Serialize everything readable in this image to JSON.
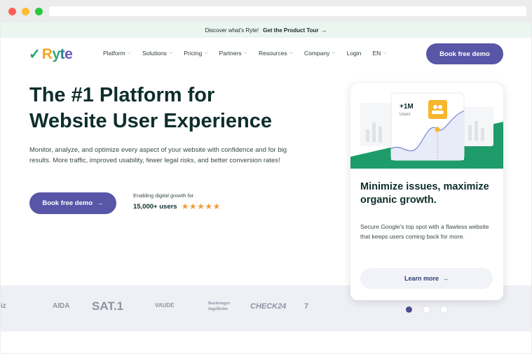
{
  "announcement": {
    "text": "Discover what's Ryte!",
    "cta": "Get the Product Tour",
    "arrow": "→"
  },
  "nav": {
    "logo_check": "✓",
    "logo": [
      "R",
      "y",
      "t",
      "e"
    ],
    "items": [
      {
        "label": "Platform",
        "has_dropdown": true
      },
      {
        "label": "Solutions",
        "has_dropdown": true
      },
      {
        "label": "Pricing",
        "has_dropdown": true
      },
      {
        "label": "Partners",
        "has_dropdown": true
      },
      {
        "label": "Resources",
        "has_dropdown": true
      },
      {
        "label": "Company",
        "has_dropdown": true
      },
      {
        "label": "Login",
        "has_dropdown": false
      },
      {
        "label": "EN",
        "has_dropdown": true
      }
    ],
    "chevron": "⌵",
    "demo_button": "Book free demo"
  },
  "hero": {
    "title_line1": "The #1 Platform for",
    "title_line2": "Website User Experience",
    "description": "Monitor, analyze, and optimize every aspect of your website with confidence and for big results. More traffic, improved usability, fewer legal risks, and better conversion rates!",
    "demo_button": "Book free demo",
    "arrow": "→",
    "growth_text": "Enabling digital growth for",
    "users": "15,000+ users",
    "stars": "★★★★★"
  },
  "card": {
    "stat_value": "+1M",
    "stat_label": "Users",
    "title": "Minimize issues, maximize organic growth.",
    "text": "Secure Google's top spot with a flawless website that keeps users coming back for more.",
    "button": "Learn more",
    "arrow": "→",
    "colors": {
      "accent_green": "#1e9c6a",
      "badge_yellow": "#f7b52c",
      "line_blue": "#5b6fc9"
    }
  },
  "carousel": {
    "slides": 3,
    "active": 0
  },
  "brands": {
    "items": [
      "iz",
      "AIDA",
      "SAT.1",
      "VAUDE",
      "Boehringer Ingelheim",
      "CHECK24",
      "7"
    ]
  },
  "colors": {
    "primary": "#5856a6",
    "heading": "#0e2e2b",
    "announce_bg": "#eaf6ef"
  }
}
